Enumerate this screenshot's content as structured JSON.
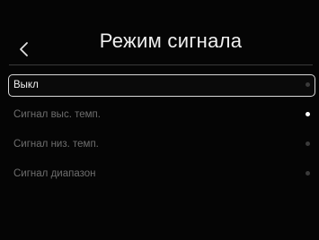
{
  "header": {
    "title": "Режим сигнала",
    "back_icon": "chevron-left-icon"
  },
  "menu": {
    "items": [
      {
        "label": "Выкл",
        "selected": true
      },
      {
        "label": "Сигнал выс. темп.",
        "active_dot": true
      },
      {
        "label": "Сигнал низ. темп.",
        "active_dot": false
      },
      {
        "label": "Сигнал диапазон",
        "active_dot": false
      }
    ]
  },
  "colors": {
    "background": "#050505",
    "text_primary": "#f0f0f0",
    "text_secondary": "#6e6e6e",
    "selection_border": "#d8d8d8"
  }
}
